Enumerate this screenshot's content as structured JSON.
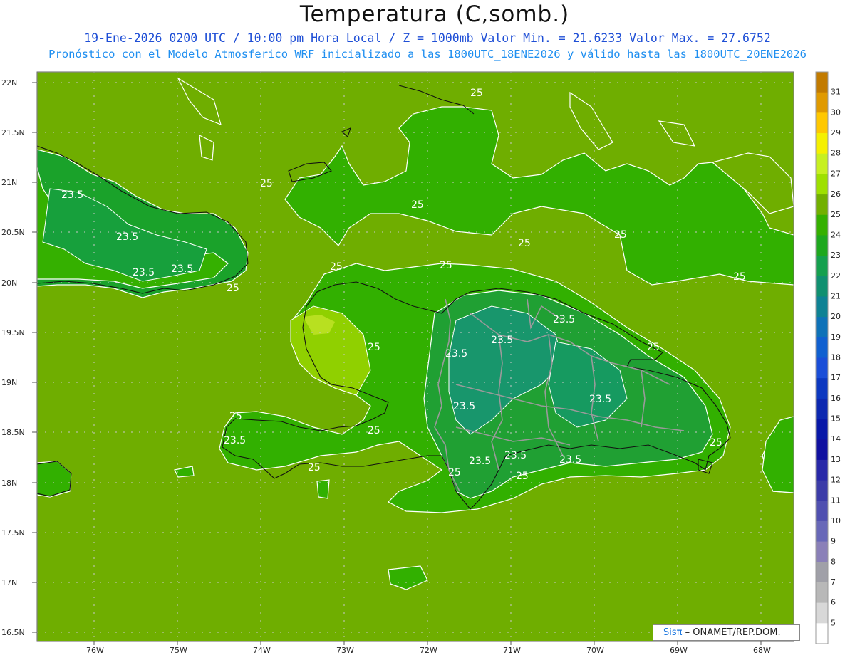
{
  "title": "Temperatura (C,somb.)",
  "subtitle1": "19-Ene-2026 0200 UTC / 10:00 pm Hora Local / Z = 1000mb  Valor Min. = 21.6233  Valor Max. = 27.6752",
  "subtitle2": "Pronóstico con el Modelo Atmosferico WRF inicializado a las 1800UTC_18ENE2026 y válido hasta las  1800UTC_20ENE2026",
  "credit": {
    "brand": "Sisπ",
    "text": " – ONAMET/REP.DOM."
  },
  "lat_labels": [
    "22N",
    "21.5N",
    "21N",
    "20.5N",
    "20N",
    "19.5N",
    "19N",
    "18.5N",
    "18N",
    "17.5N",
    "17N",
    "16.5N"
  ],
  "lon_labels": [
    "76W",
    "75W",
    "74W",
    "73W",
    "72W",
    "71W",
    "70W",
    "69W",
    "68W"
  ],
  "contour_labels": [
    "25",
    "25",
    "25",
    "25",
    "25",
    "25",
    "25",
    "25",
    "25",
    "25",
    "25",
    "25",
    "25",
    "25",
    "25",
    "25",
    "25",
    "23.5",
    "23.5",
    "23.5",
    "23.5",
    "23.5",
    "23.5",
    "23.5",
    "23.5",
    "23.5",
    "23.5",
    "23.5",
    "23.5",
    "23.5"
  ],
  "colorbar": {
    "labels": [
      "31",
      "30",
      "29",
      "28",
      "27",
      "26",
      "25",
      "24",
      "23",
      "22",
      "21",
      "20",
      "19",
      "18",
      "17",
      "16",
      "15",
      "14",
      "13",
      "12",
      "11",
      "10",
      "9",
      "8",
      "7",
      "6",
      "5"
    ],
    "colors": [
      "#c27b00",
      "#e09a00",
      "#ffc800",
      "#f5f000",
      "#c7f020",
      "#9ee000",
      "#72b000",
      "#35b000",
      "#1ea81e",
      "#15a04e",
      "#109070",
      "#0e8294",
      "#0e72b8",
      "#1060d0",
      "#1a4ed8",
      "#0c38c0",
      "#0c28b0",
      "#0818a8",
      "#1010a0",
      "#2828a8",
      "#3c3ca8",
      "#5050b0",
      "#6868b8",
      "#8a80b8",
      "#a0a0a8",
      "#b8b8b8",
      "#d8d8d8",
      "#ffffff"
    ]
  }
}
